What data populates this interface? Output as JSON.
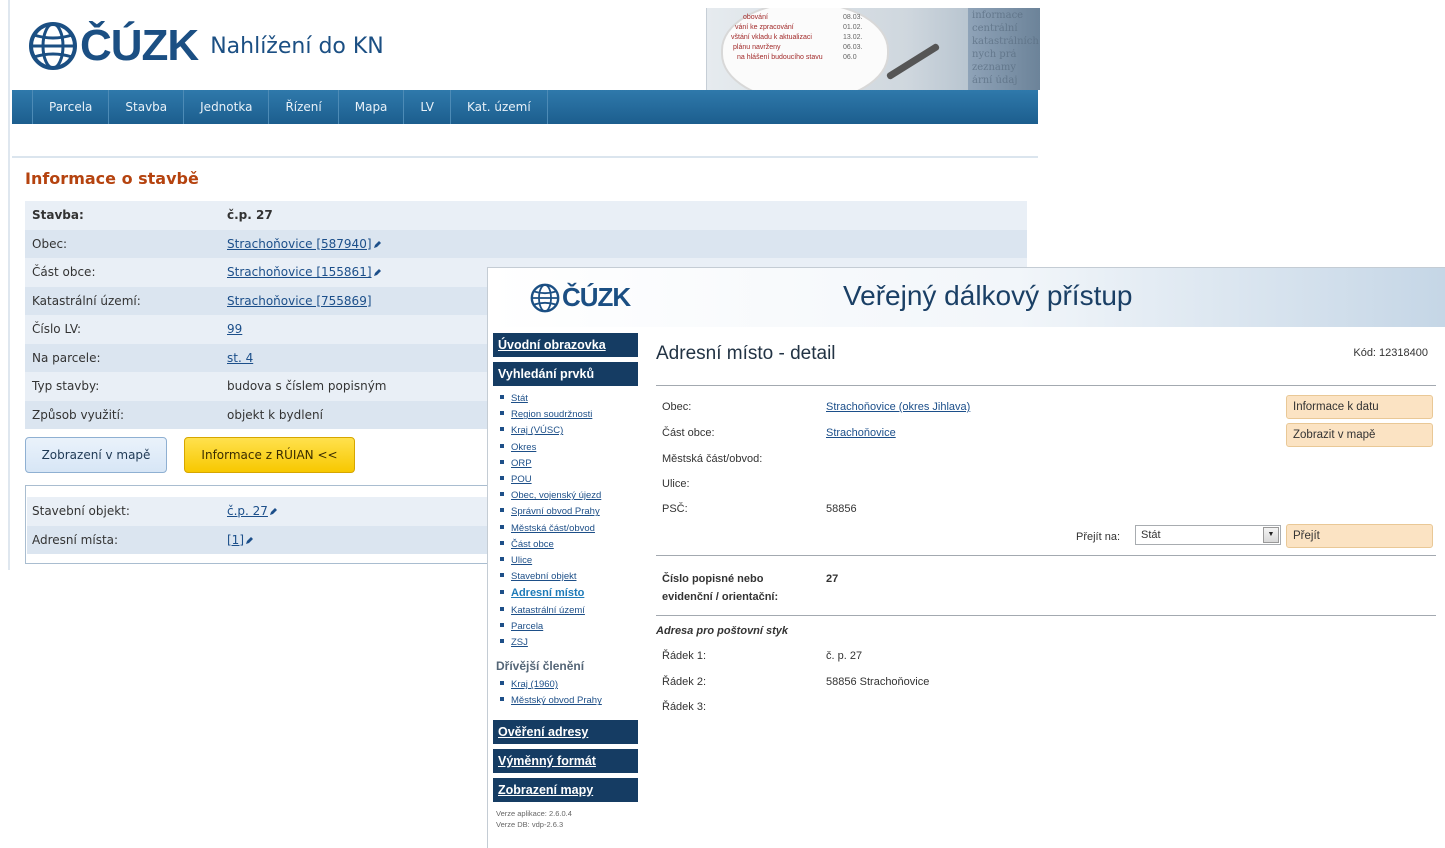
{
  "kn": {
    "logo_text": "ČÚZK",
    "app_title": "Nahlížení do KN",
    "banner": {
      "lines": [
        "obování",
        "vání ke zpracování",
        "vštání vkladu k aktualizaci",
        "plánu navrženy",
        "na hlášení budoucího stavu"
      ],
      "dates": [
        "08.03.",
        "01.02.",
        "13.02.",
        "06.03.",
        "06.0"
      ],
      "words": [
        "informace",
        "centrální",
        "katastrálních",
        "nych prá",
        "zeznamy",
        "ární údaj"
      ]
    },
    "nav": [
      "Parcela",
      "Stavba",
      "Jednotka",
      "Řízení",
      "Mapa",
      "LV",
      "Kat. území"
    ],
    "section_title": "Informace o stavbě",
    "rows": [
      {
        "label": "Stavba:",
        "value": "č.p. 27",
        "link": false,
        "pencil": false
      },
      {
        "label": "Obec:",
        "value": "Strachoňovice [587940]",
        "link": true,
        "pencil": true
      },
      {
        "label": "Část obce:",
        "value": "Strachoňovice [155861]",
        "link": true,
        "pencil": true
      },
      {
        "label": "Katastrální území:",
        "value": "Strachoňovice [755869]",
        "link": true,
        "pencil": false
      },
      {
        "label": "Číslo LV:",
        "value": "99",
        "link": true,
        "pencil": false
      },
      {
        "label": "Na parcele:",
        "value": "st. 4",
        "link": true,
        "pencil": false
      },
      {
        "label": "Typ stavby:",
        "value": "budova s číslem popisným",
        "link": false,
        "pencil": false
      },
      {
        "label": "Způsob využití:",
        "value": "objekt k bydlení",
        "link": false,
        "pencil": false
      }
    ],
    "btn_map": "Zobrazení v mapě",
    "btn_ruian": "Informace z RÚIAN <<",
    "ruian_rows": [
      {
        "label": "Stavební objekt:",
        "value": "č.p. 27"
      },
      {
        "label": "Adresní místa:",
        "value": "[1]"
      }
    ]
  },
  "vdp": {
    "logo_text": "ČÚZK",
    "title": "Veřejný dálkový přístup",
    "sidebar": {
      "home": "Úvodní obrazovka",
      "search": "Vyhledání prvků",
      "items": [
        "Stát",
        "Region soudržnosti",
        "Kraj (VÚSC)",
        "Okres",
        "ORP",
        "POU",
        "Obec, vojenský újezd",
        "Správní obvod Prahy",
        "Městská část/obvod",
        "Část obce",
        "Ulice",
        "Stavební objekt",
        "Adresní místo",
        "Katastrální území",
        "Parcela",
        "ZSJ"
      ],
      "active_item": "Adresní místo",
      "older_title": "Dřívější členění",
      "older_items": [
        "Kraj (1960)",
        "Městský obvod Prahy"
      ],
      "verify": "Ověření adresy",
      "exchange": "Výměnný formát",
      "mapview": "Zobrazení mapy",
      "version_app": "Verze aplikace: 2.6.0.4",
      "version_db": "Verze DB: vdp-2.6.3"
    },
    "detail": {
      "title": "Adresní místo - detail",
      "code": "Kód: 12318400",
      "obec_label": "Obec:",
      "obec_value": "Strachoňovice (okres Jihlava)",
      "cast_label": "Část obce:",
      "cast_value": "Strachoňovice",
      "mestska_label": "Městská část/obvod:",
      "ulice_label": "Ulice:",
      "psc_label": "PSČ:",
      "psc_value": "58856",
      "btn_info": "Informace k datu",
      "btn_map": "Zobrazit v mapě",
      "goto_label": "Přejít na:",
      "goto_value": "Stát",
      "goto_btn": "Přejít",
      "cislo_label_1": "Číslo popisné nebo",
      "cislo_label_2": "evidenční / orientační:",
      "cislo_value": "27",
      "postal_title": "Adresa pro poštovní styk",
      "r1_label": "Řádek 1:",
      "r1_value": "č. p. 27",
      "r2_label": "Řádek 2:",
      "r2_value": "58856 Strachoňovice",
      "r3_label": "Řádek 3:"
    }
  }
}
